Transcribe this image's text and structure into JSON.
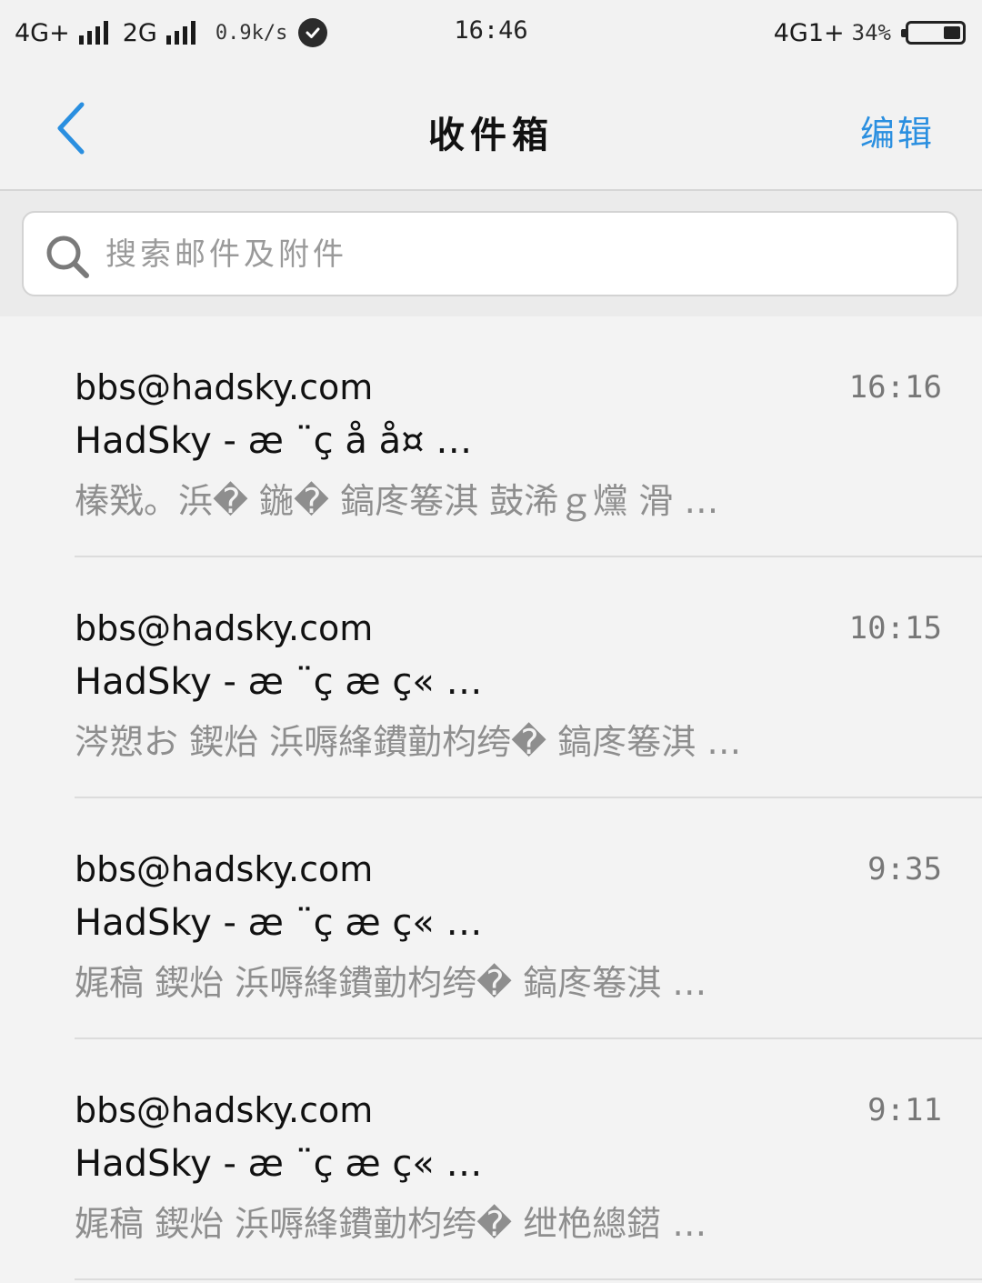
{
  "status_bar": {
    "network_1": "4G+",
    "network_2": "2G",
    "speed": "0.9k/s",
    "time": "16:46",
    "network_right": "4G1+",
    "battery_percent": "34%",
    "battery_level": 0.34
  },
  "nav": {
    "title": "收件箱",
    "edit_label": "编辑"
  },
  "search": {
    "placeholder": "搜索邮件及附件"
  },
  "mails": [
    {
      "sender": "bbs@hadsky.com",
      "time": "16:16",
      "subject": "HadSky - æ ¨ç  å  å¤ …",
      "preview": "榛戣。浜� 鍦� 鎬庝箞淇 鼓浠ｇ爣 滑 …"
    },
    {
      "sender": "bbs@hadsky.com",
      "time": "10:15",
      "subject": "HadSky - æ ¨ç  æ  ç« …",
      "preview": "涔愬お 鍥炲 浜嗕綘鐨勭枃绔� 鎬庝箞淇 …"
    },
    {
      "sender": "bbs@hadsky.com",
      "time": "9:35",
      "subject": "HadSky - æ ¨ç  æ  ç« …",
      "preview": "娓稿 鍥炲 浜嗕綘鐨勭枃绔� 鎬庝箞淇 …"
    },
    {
      "sender": "bbs@hadsky.com",
      "time": "9:11",
      "subject": "HadSky - æ ¨ç  æ  ç« …",
      "preview": "娓稿 鍥炲 浜嗕綘鐨勭枃绔� 绁栬總鍣 …"
    }
  ]
}
